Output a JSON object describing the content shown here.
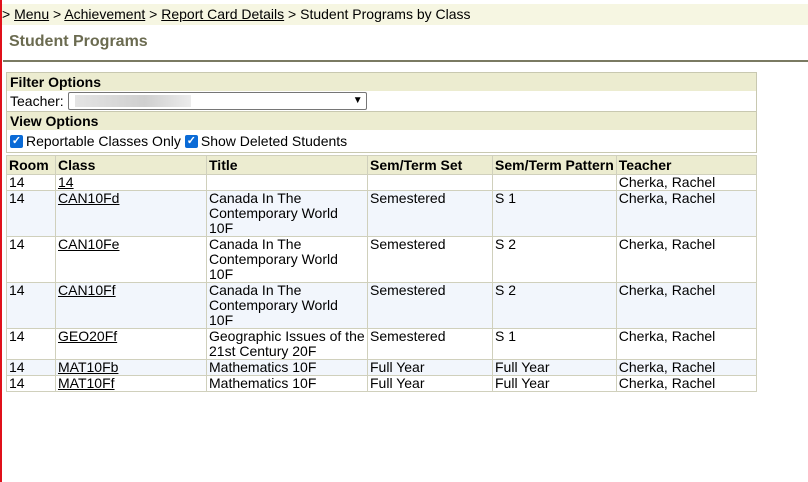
{
  "breadcrumb": {
    "lead": ">",
    "items": [
      "Menu",
      "Achievement",
      "Report Card Details"
    ],
    "current": "Student Programs by Class",
    "separator": ">"
  },
  "page": {
    "title": "Student Programs"
  },
  "filter": {
    "heading": "Filter Options",
    "teacher_label": "Teacher:"
  },
  "view": {
    "heading": "View Options",
    "reportable_label": "Reportable Classes Only",
    "deleted_label": "Show Deleted Students"
  },
  "table": {
    "headers": [
      "Room",
      "Class",
      "Title",
      "Sem/Term Set",
      "Sem/Term Pattern",
      "Teacher"
    ],
    "rows": [
      {
        "room": "14",
        "class": "14",
        "title": "",
        "set": "",
        "pattern": "",
        "teacher": "Cherka, Rachel"
      },
      {
        "room": "14",
        "class": "CAN10Fd",
        "title": "Canada In The Contemporary World 10F",
        "set": "Semestered",
        "pattern": "S 1",
        "teacher": "Cherka, Rachel"
      },
      {
        "room": "14",
        "class": "CAN10Fe",
        "title": "Canada In The Contemporary World 10F",
        "set": "Semestered",
        "pattern": "S 2",
        "teacher": "Cherka, Rachel"
      },
      {
        "room": "14",
        "class": "CAN10Ff",
        "title": "Canada In The Contemporary World 10F",
        "set": "Semestered",
        "pattern": "S 2",
        "teacher": "Cherka, Rachel"
      },
      {
        "room": "14",
        "class": "GEO20Ff",
        "title": "Geographic Issues of the 21st Century 20F",
        "set": "Semestered",
        "pattern": "S 1",
        "teacher": "Cherka, Rachel"
      },
      {
        "room": "14",
        "class": "MAT10Fb",
        "title": "Mathematics 10F",
        "set": "Full Year",
        "pattern": "Full Year",
        "teacher": "Cherka, Rachel"
      },
      {
        "room": "14",
        "class": "MAT10Ff",
        "title": "Mathematics 10F",
        "set": "Full Year",
        "pattern": "Full Year",
        "teacher": "Cherka, Rachel"
      }
    ]
  }
}
